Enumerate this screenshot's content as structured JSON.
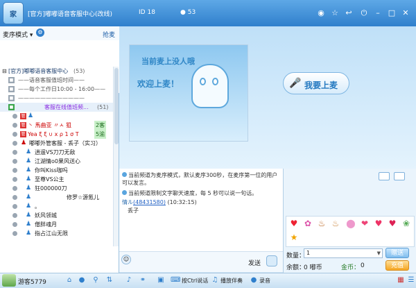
{
  "window": {
    "logo": "家",
    "title": "[官方]嘟嘟语音客服中心(改线)",
    "id_label": "ID",
    "id_value": "18",
    "user_count": "53",
    "buttons": [
      "eye-icon",
      "star-icon",
      "back-icon",
      "power-icon",
      "minimize-icon",
      "maximize-icon",
      "close-icon"
    ]
  },
  "sidebar": {
    "mode_label": "麦序模式",
    "grab_label": "抢麦",
    "tree": [
      {
        "text": "[官方]嘟嘟语音客服中心",
        "count": "(53)"
      },
      {
        "text": "——语音客服值班时间——"
      },
      {
        "text": "——每个工作日10:00 - 16:00——"
      },
      {
        "text": "————————————"
      },
      {
        "text": "客服在线值班频...",
        "count": "(51)"
      },
      {
        "text": ""
      },
      {
        "text": "丶 馬曲亚 〃ㅅ 狙",
        "badge": "2客"
      },
      {
        "text": "Yea ξ ξ ∪ x ρ 1 σ T",
        "badge": "5渝"
      },
      {
        "text": "嘟嘟外管客服 - 丢子（实习）"
      },
      {
        "text": "逍遥VS刀刀无敌"
      },
      {
        "text": "江湖情o0果风送心"
      },
      {
        "text": "你叫Kiss咖吗"
      },
      {
        "text": "至尊VS公主"
      },
      {
        "text": "狂000000刀"
      },
      {
        "text": "修罗☆源氪儿"
      },
      {
        "text": "。"
      },
      {
        "text": "妖风领城"
      },
      {
        "text": "僧胖魂月"
      },
      {
        "text": "指占江山无限"
      }
    ]
  },
  "stage": {
    "screen_line1": "当前麦上没人哦",
    "screen_line2": "欢迎上麦！",
    "mic_label": "我要上麦"
  },
  "chat": {
    "notice1": "当前频道为麦序模式，默认麦序300秒，在麦序第一位的用户可以发言。",
    "notice2": "当前频道限制文字聊天速度，每 5 秒可以说一句话。",
    "msg_name": "情ル",
    "msg_id": "(48431580)",
    "msg_time": "(10:32:15)",
    "msg_text": "丢子",
    "input_value": "",
    "send_label": "发送"
  },
  "gifts": {
    "items": [
      "lips-icon",
      "flower-icon",
      "cake-icon",
      "cake2-icon",
      "egg-icon",
      "heart-icon",
      "lipstick-icon",
      "kiss-icon",
      "candy-icon",
      "star-gift-icon"
    ],
    "qty_label": "数量：",
    "qty_value": "1",
    "give_label": "赠送",
    "balance_label": "余额：",
    "balance_value": "0 嘟币",
    "coin_label": "金币：",
    "coin_value": "0",
    "recharge_label": "充值"
  },
  "bottom": {
    "username": "游客5779",
    "ctrl_label": "按Ctrl说话",
    "music_label": "播放伴奏",
    "record_label": "录音"
  }
}
